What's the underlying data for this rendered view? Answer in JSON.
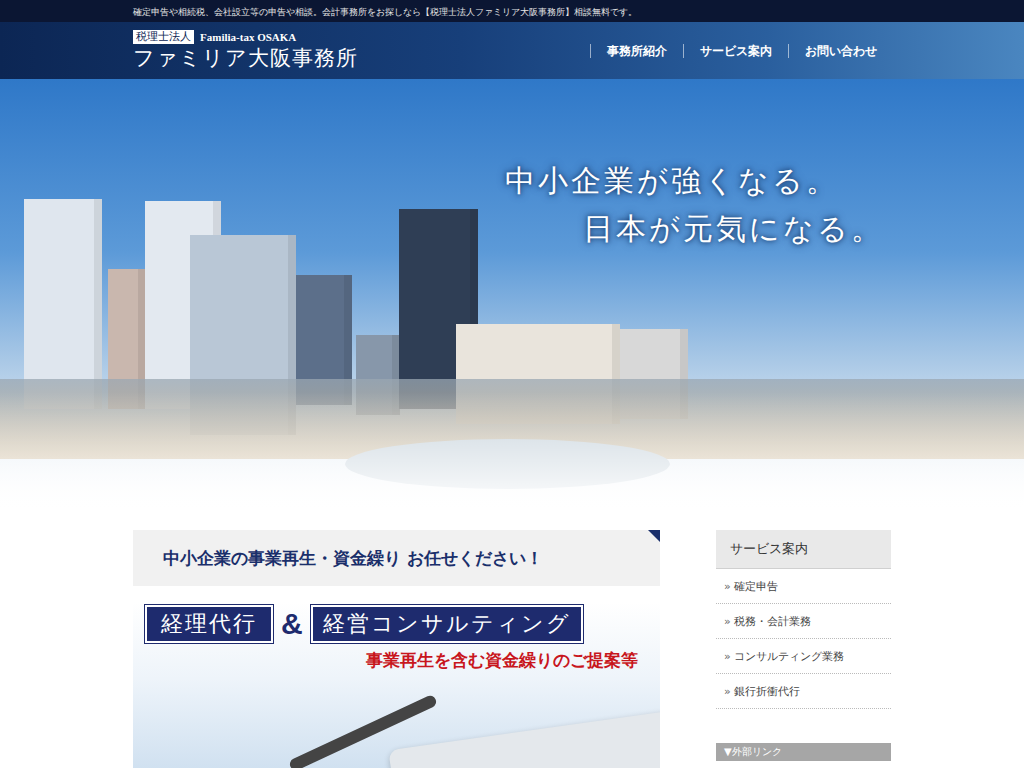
{
  "top_bar": {
    "text": "確定申告や相続税、会社設立等の申告や相談。会計事務所をお探しなら【税理士法人ファミリア大阪事務所】相談無料です。"
  },
  "header": {
    "logo": {
      "badge": "税理士法人",
      "english": "Familia-tax OSAKA",
      "name": "ファミリア大阪事務所"
    },
    "nav": [
      {
        "label": "事務所紹介"
      },
      {
        "label": "サービス案内"
      },
      {
        "label": "お問い合わせ"
      }
    ]
  },
  "hero": {
    "slogan": [
      "中小企業が強くなる。",
      "日本が元気になる。"
    ]
  },
  "main": {
    "heading": "中小企業の事業再生・資金繰り お任せください！",
    "banner": {
      "labels": [
        {
          "text": "経理代行",
          "kind": "box"
        },
        {
          "text": "&",
          "kind": "amp"
        },
        {
          "text": "経営コンサルティング",
          "kind": "box"
        }
      ],
      "subtitle": "事業再生を含む資金繰りのご提案等"
    }
  },
  "sidebar": {
    "title": "サービス案内",
    "bullet": "»",
    "items": [
      {
        "label": "確定申告"
      },
      {
        "label": "税務・会計業務"
      },
      {
        "label": "コンサルティング業務"
      },
      {
        "label": "銀行折衝代行"
      }
    ],
    "links_title": "▼外部リンク"
  }
}
